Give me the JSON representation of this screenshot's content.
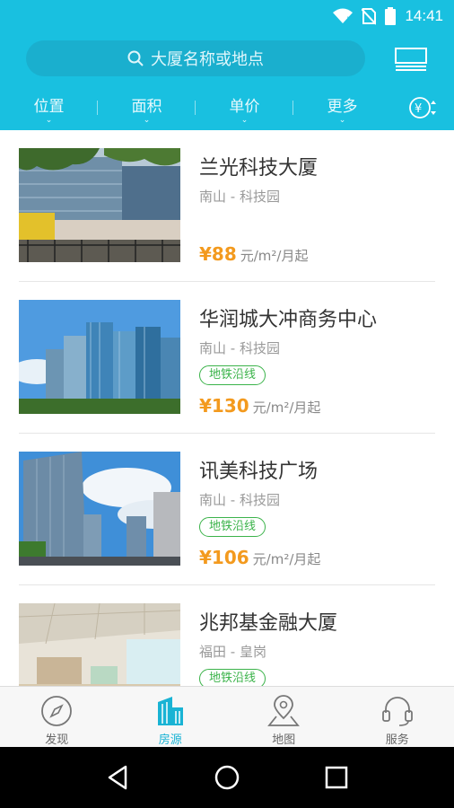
{
  "status_bar": {
    "time": "14:41"
  },
  "search": {
    "placeholder": "大厦名称或地点"
  },
  "filters": [
    {
      "label": "位置"
    },
    {
      "label": "面积"
    },
    {
      "label": "单价"
    },
    {
      "label": "更多"
    }
  ],
  "listings": [
    {
      "name": "兰光科技大厦",
      "location": "南山 - 科技园",
      "tag": "",
      "price": "¥88",
      "unit": "元/m²/月起"
    },
    {
      "name": "华润城大冲商务中心",
      "location": "南山 - 科技园",
      "tag": "地铁沿线",
      "price": "¥130",
      "unit": "元/m²/月起"
    },
    {
      "name": "讯美科技广场",
      "location": "南山 - 科技园",
      "tag": "地铁沿线",
      "price": "¥106",
      "unit": "元/m²/月起"
    },
    {
      "name": "兆邦基金融大厦",
      "location": "福田 - 皇岗",
      "tag": "地铁沿线",
      "price": "",
      "unit": ""
    }
  ],
  "tabs": [
    {
      "label": "发现",
      "icon": "compass-icon"
    },
    {
      "label": "房源",
      "icon": "building-icon"
    },
    {
      "label": "地图",
      "icon": "map-pin-icon"
    },
    {
      "label": "服务",
      "icon": "headset-icon"
    }
  ],
  "colors": {
    "primary": "#19c0e0",
    "price": "#f39a1e",
    "tag": "#3bb34a"
  }
}
